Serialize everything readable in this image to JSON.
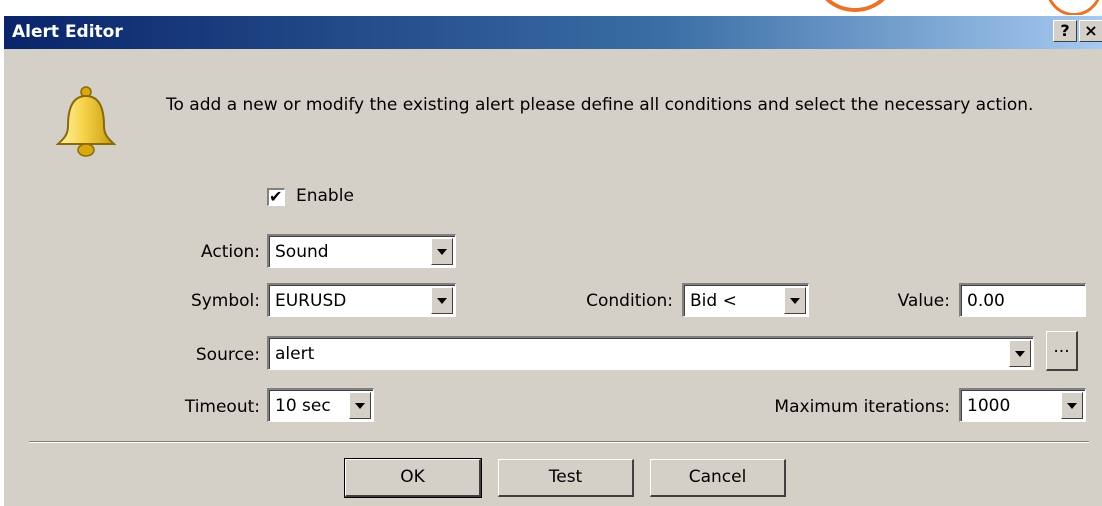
{
  "window": {
    "title": "Alert Editor",
    "help_glyph": "?",
    "close_glyph": "×"
  },
  "instruction": "To add a new or modify the existing alert please define all conditions and select the necessary action.",
  "enable": {
    "label": "Enable",
    "checked": true,
    "check_glyph": "✔"
  },
  "fields": {
    "action": {
      "label": "Action:",
      "value": "Sound"
    },
    "symbol": {
      "label": "Symbol:",
      "value": "EURUSD"
    },
    "condition": {
      "label": "Condition:",
      "value": "Bid <"
    },
    "value": {
      "label": "Value:",
      "value": "0.00"
    },
    "source": {
      "label": "Source:",
      "value": "alert",
      "browse_label": "..."
    },
    "timeout": {
      "label": "Timeout:",
      "value": "10 sec"
    },
    "max_iterations": {
      "label": "Maximum iterations:",
      "value": "1000"
    }
  },
  "buttons": {
    "ok": "OK",
    "test": "Test",
    "cancel": "Cancel"
  },
  "colors": {
    "dialog_bg": "#d4d0c8",
    "title_start": "#0a246a",
    "title_end": "#a6caf0",
    "accent_orange": "#e8732a",
    "bell_yellow": "#f2c22c"
  },
  "icons": {
    "bell": "bell-icon"
  }
}
